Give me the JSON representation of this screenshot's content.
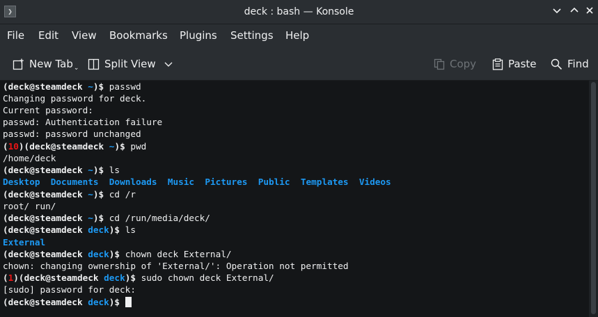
{
  "window": {
    "title": "deck : bash — Konsole",
    "app_icon_glyph": "❯"
  },
  "menubar": {
    "items": [
      "File",
      "Edit",
      "View",
      "Bookmarks",
      "Plugins",
      "Settings",
      "Help"
    ]
  },
  "toolbar": {
    "new_tab": "New Tab",
    "split_view": "Split View",
    "copy": "Copy",
    "paste": "Paste",
    "find": "Find"
  },
  "terminal": {
    "prompt_user": "deck@steamdeck",
    "lines": {
      "l1_cmd": "passwd",
      "l2": "Changing password for deck.",
      "l3": "Current password:",
      "l4": "passwd: Authentication failure",
      "l5": "passwd: password unchanged",
      "l6_code": "10",
      "l6_cmd": "pwd",
      "l7": "/home/deck",
      "l8_cmd": "ls",
      "l9_dirs": [
        "Desktop",
        "Documents",
        "Downloads",
        "Music",
        "Pictures",
        "Public",
        "Templates",
        "Videos"
      ],
      "l10_cmd": "cd /r",
      "l11": "root/ run/",
      "l12_cmd": "cd /run/media/deck/",
      "l13_cmd": "ls",
      "l14": "External",
      "l15_cmd": "chown deck External/",
      "l16": "chown: changing ownership of 'External/': Operation not permitted",
      "l17_code": "1",
      "l17_cmd": "sudo chown deck External/",
      "l18": "[sudo] password for deck:"
    },
    "cwd_home": "~",
    "cwd_deck": "deck"
  },
  "colors": {
    "accent_blue": "#1d99f3",
    "error_red": "#ed1515",
    "terminal_bg": "#141618"
  }
}
